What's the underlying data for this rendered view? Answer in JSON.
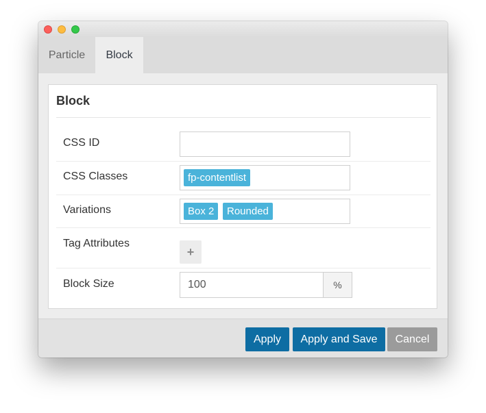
{
  "window": {
    "controls": [
      "close",
      "minimize",
      "zoom"
    ]
  },
  "tabs": [
    {
      "label": "Particle",
      "active": false
    },
    {
      "label": "Block",
      "active": true
    }
  ],
  "panel": {
    "title": "Block",
    "fields": {
      "css_id": {
        "label": "CSS ID",
        "value": ""
      },
      "css_classes": {
        "label": "CSS Classes",
        "tags": [
          "fp-contentlist"
        ]
      },
      "variations": {
        "label": "Variations",
        "tags": [
          "Box 2",
          "Rounded"
        ]
      },
      "tag_attributes": {
        "label": "Tag Attributes",
        "add_button": "+"
      },
      "block_size": {
        "label": "Block Size",
        "value": "100",
        "unit": "%"
      }
    }
  },
  "footer": {
    "apply": "Apply",
    "apply_save": "Apply and Save",
    "cancel": "Cancel"
  },
  "colors": {
    "primary_button": "#0e6da3",
    "cancel_button": "#9b9b9b",
    "tag": "#4ab3da",
    "close": "#fc605c",
    "minimize": "#fdbc40",
    "zoom": "#34c84a"
  }
}
